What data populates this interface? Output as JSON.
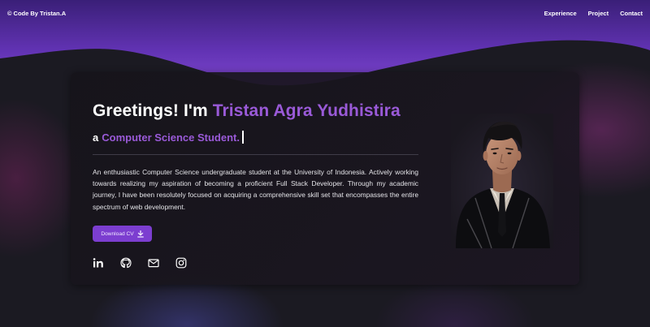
{
  "navbar": {
    "brand_symbol": "©",
    "brand_text": "Code By Tristan.A",
    "links": [
      {
        "label": "Experience"
      },
      {
        "label": "Project"
      },
      {
        "label": "Contact"
      }
    ]
  },
  "hero": {
    "greeting_prefix": "Greetings! I'm ",
    "greeting_name": "Tristan Agra Yudhistira",
    "subtitle_prefix": "a",
    "subtitle_role": "Computer Science Student.",
    "description": "An enthusiastic Computer Science undergraduate student at the University of Indonesia. Actively working towards realizing my aspiration of becoming a proficient Full Stack Developer. Through my academic journey, I have been resolutely focused on acquiring a comprehensive skill set that encompasses the entire spectrum of web development.",
    "cv_button_label": "Download CV",
    "cv_button_icon": "download-icon"
  },
  "socials": [
    {
      "name": "linkedin-icon"
    },
    {
      "name": "github-icon"
    },
    {
      "name": "mail-icon"
    },
    {
      "name": "instagram-icon"
    }
  ],
  "colors": {
    "accent": "#9a5ad8",
    "button": "#7c3ed0",
    "card_bg": "#17151b",
    "page_bg": "#1b1a22",
    "wave_top": "#4a2890",
    "wave_bottom": "#7a45c8"
  }
}
